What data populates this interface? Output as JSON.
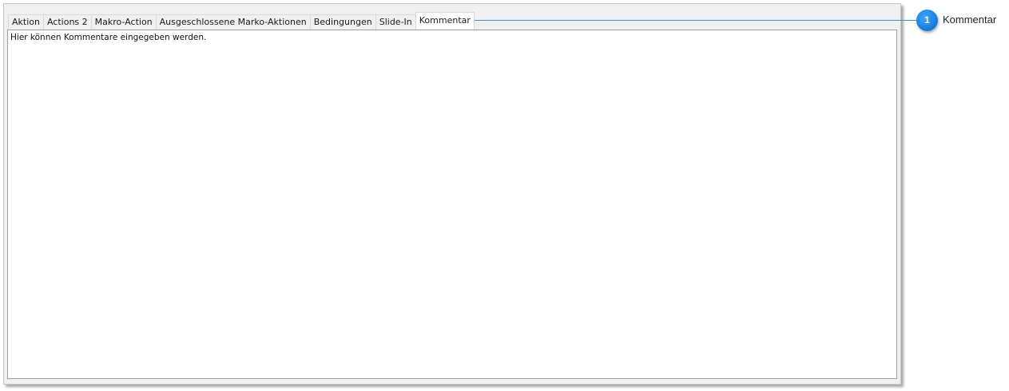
{
  "tabs": [
    {
      "label": "Aktion"
    },
    {
      "label": "Actions 2"
    },
    {
      "label": "Makro-Action"
    },
    {
      "label": "Ausgeschlossene Marko-Aktionen"
    },
    {
      "label": "Bedingungen"
    },
    {
      "label": "Slide-In"
    },
    {
      "label": "Kommentar",
      "active": true
    }
  ],
  "comment": {
    "text": "Hier können Kommentare eingegeben werden."
  },
  "callout": {
    "number": "1",
    "label": "Kommentar",
    "color": "#1c7fe0"
  }
}
